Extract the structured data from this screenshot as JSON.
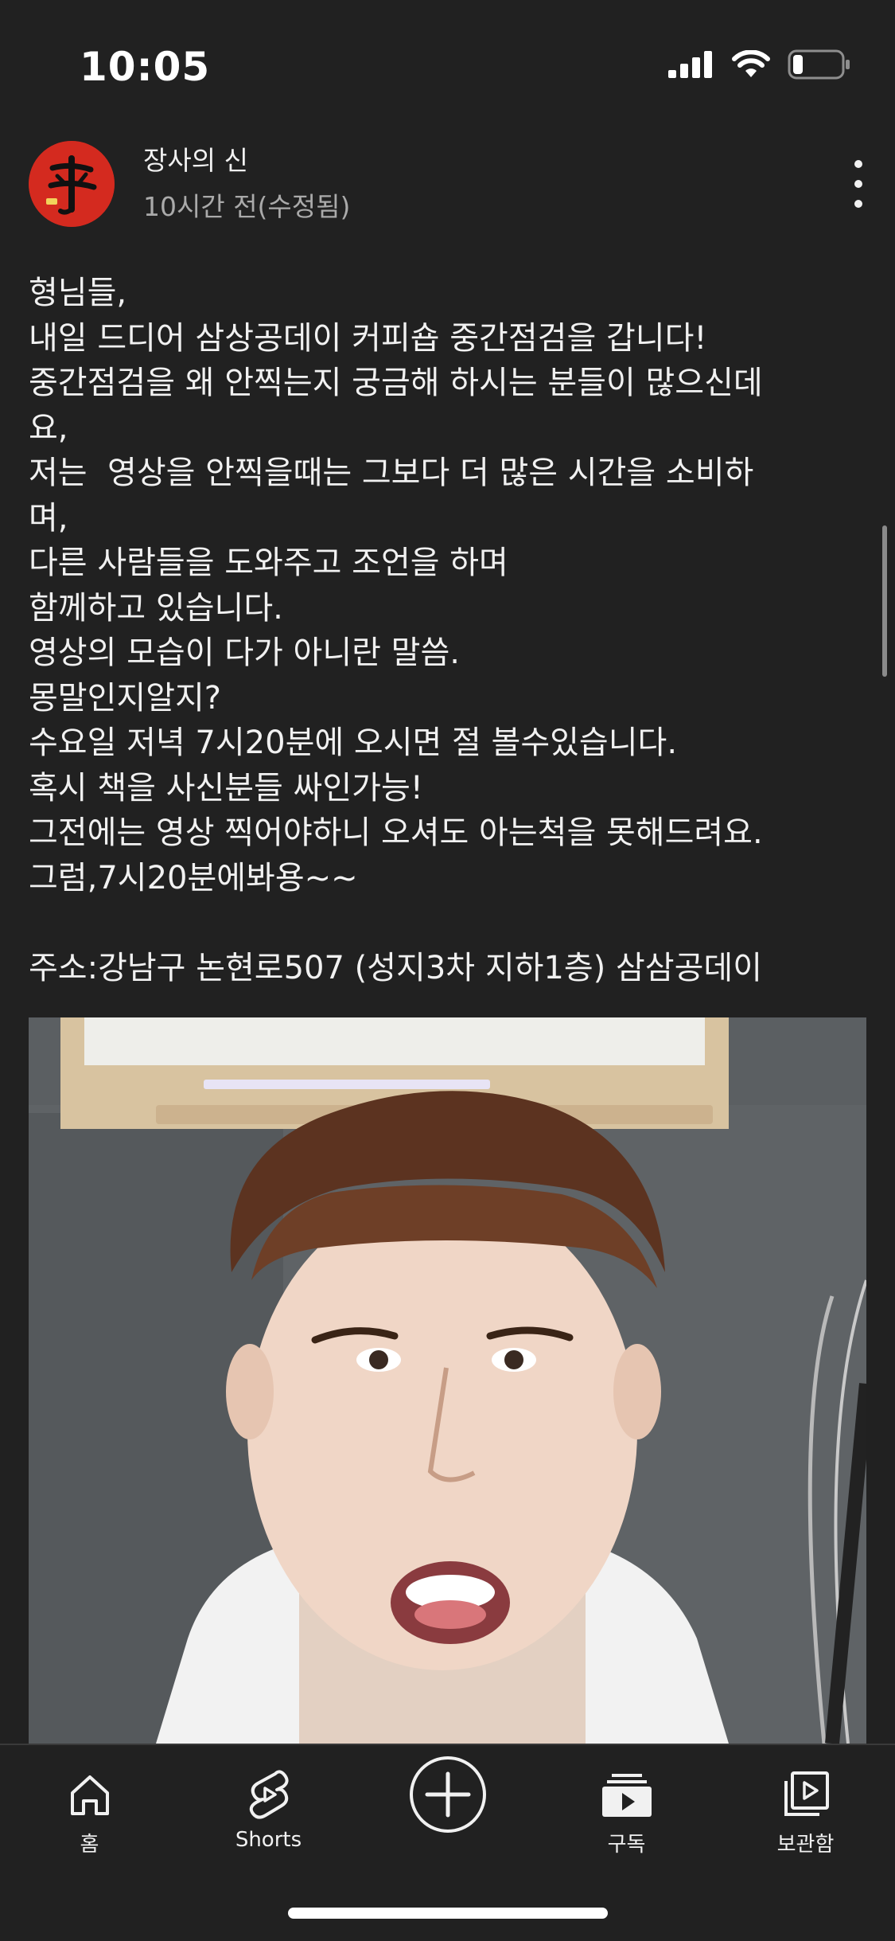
{
  "status_bar": {
    "time": "10:05",
    "icons": [
      "signal-icon",
      "wifi-icon",
      "battery-icon"
    ]
  },
  "post": {
    "channel_name": "장사의 신",
    "timestamp": "10시간 전(수정됨)",
    "body_lines": [
      "형님들,",
      "내일 드디어 삼상공데이 커피숍 중간점검을 갑니다!",
      "중간점검을 왜 안찍는지 궁금해 하시는 분들이 많으신데",
      "요,",
      "저는  영상을 안찍을때는 그보다 더 많은 시간을 소비하",
      "며,",
      "다른 사람들을 도와주고 조언을 하며",
      "함께하고 있습니다.",
      "영상의 모습이 다가 아니란 말씀.",
      "몽말인지알지?",
      "수요일 저녁 7시20분에 오시면 절 볼수있습니다.",
      "혹시 책을 사신분들 싸인가능!",
      "그전에는 영상 찍어야하니 오셔도 아는척을 못해드려요.",
      "그럼,7시20분에봐용~~",
      "",
      "주소:강남구 논현로507 (성지3차 지하1층) 삼삼공데이"
    ]
  },
  "nav": {
    "items": [
      {
        "label": "홈",
        "icon": "home-icon"
      },
      {
        "label": "Shorts",
        "icon": "shorts-icon"
      },
      {
        "label": "",
        "icon": "create-icon"
      },
      {
        "label": "구독",
        "icon": "subscriptions-icon"
      },
      {
        "label": "보관함",
        "icon": "library-icon"
      }
    ]
  },
  "colors": {
    "background": "#212121",
    "text": "#f1f1f1",
    "secondary_text": "#aaaaaa",
    "avatar_red": "#d42a1f"
  }
}
